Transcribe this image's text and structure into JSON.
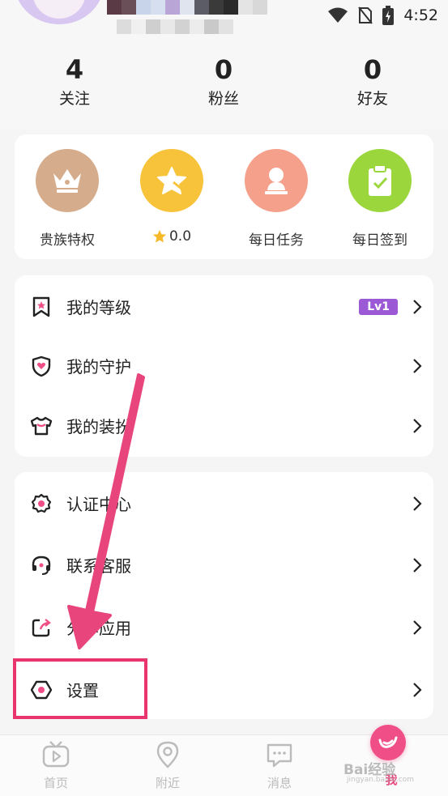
{
  "status_bar": {
    "time": "4:52"
  },
  "profile": {
    "stats": [
      {
        "count": "4",
        "label": "关注"
      },
      {
        "count": "0",
        "label": "粉丝"
      },
      {
        "count": "0",
        "label": "好友"
      }
    ]
  },
  "quick_actions": [
    {
      "label": "贵族特权",
      "icon": "crown-icon",
      "color": "#d6ad8c"
    },
    {
      "label": "0.0",
      "icon": "star-icon",
      "color": "#f7c33a"
    },
    {
      "label": "每日任务",
      "icon": "person-icon",
      "color": "#f5a08a"
    },
    {
      "label": "每日签到",
      "icon": "clipboard-check-icon",
      "color": "#9bd63c"
    }
  ],
  "menu_group_1": [
    {
      "label": "我的等级",
      "icon": "bookmark-star-icon",
      "badge": "Lv1"
    },
    {
      "label": "我的守护",
      "icon": "shield-heart-icon"
    },
    {
      "label": "我的装扮",
      "icon": "shirt-icon"
    }
  ],
  "menu_group_2": [
    {
      "label": "认证中心",
      "icon": "badge-icon"
    },
    {
      "label": "联系客服",
      "icon": "headset-icon"
    },
    {
      "label": "分享应用",
      "icon": "share-icon"
    },
    {
      "label": "设置",
      "icon": "settings-icon"
    }
  ],
  "tabbar": [
    {
      "label": "首页",
      "icon": "tv-icon"
    },
    {
      "label": "附近",
      "icon": "location-pin-icon"
    },
    {
      "label": "消息",
      "icon": "chat-icon"
    },
    {
      "label": "我",
      "icon": "me-icon",
      "active": true
    }
  ],
  "accent_color": "#e8457d",
  "watermark": {
    "brand": "Bai经验",
    "url": "jingyan.baidu.com"
  }
}
